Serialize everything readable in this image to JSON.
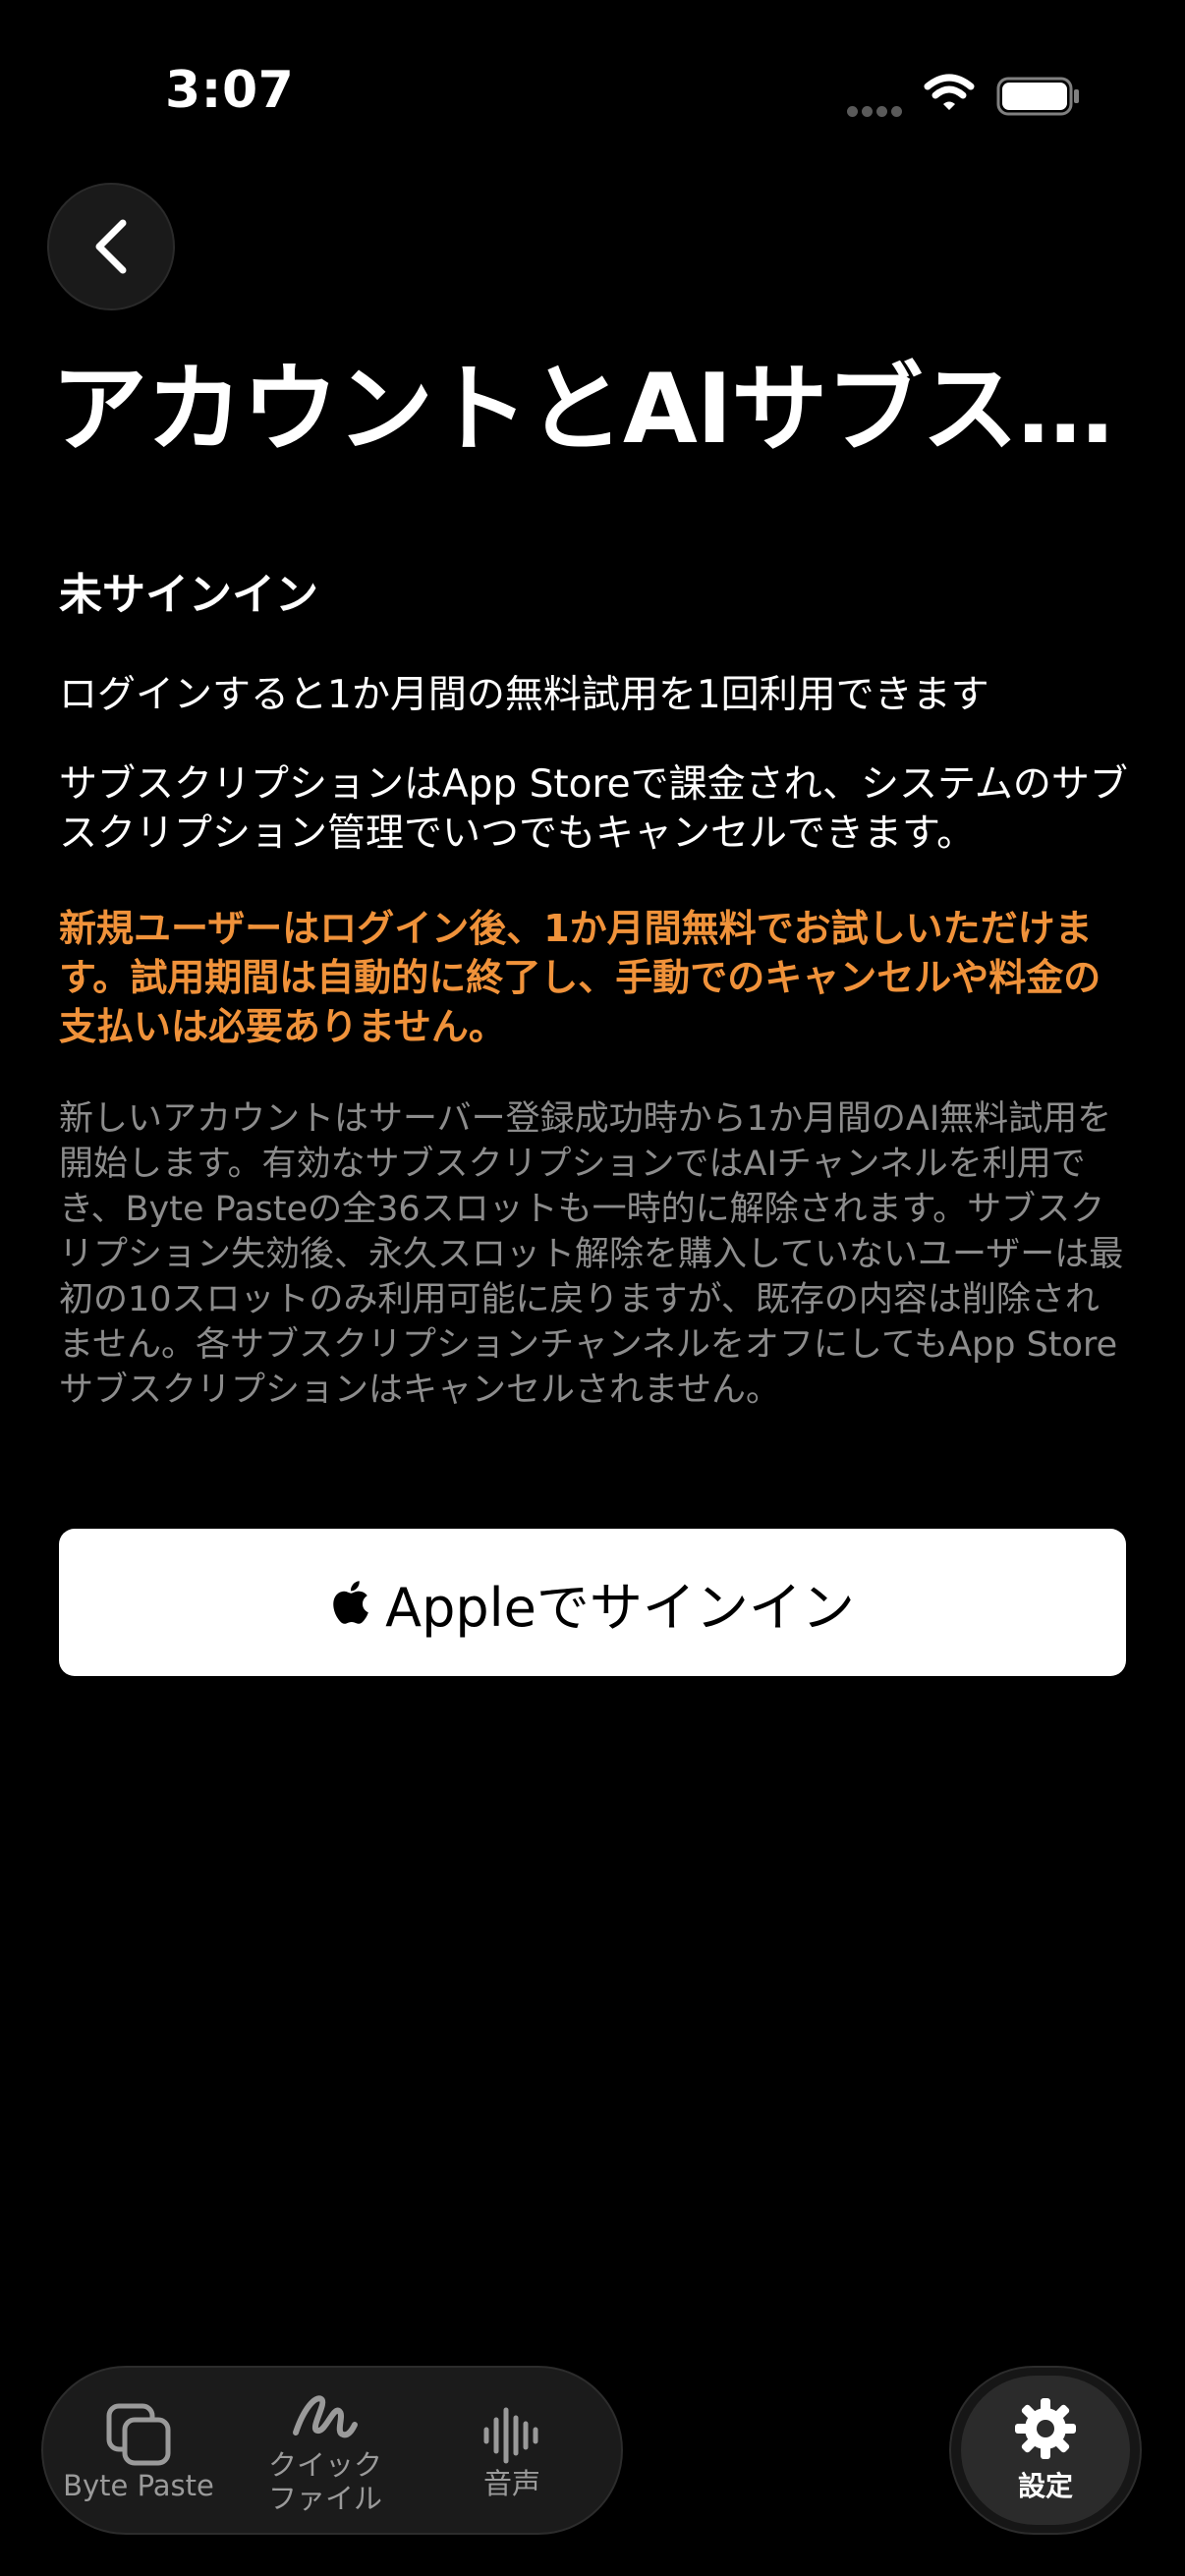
{
  "status_bar": {
    "time": "3:07"
  },
  "header": {
    "title": "アカウントとAIサブス…"
  },
  "account": {
    "status": "未サインイン",
    "trial_info": "ログインすると1か月間の無料試用を1回利用できます",
    "subscription_info": "サブスクリプションはApp Storeで課金され、システムのサブスクリプション管理でいつでもキャンセルできます。",
    "promo": "新規ユーザーはログイン後、1か月間無料でお試しいただけます。試用期間は自動的に終了し、手動でのキャンセルや料金の支払いは必要ありません。",
    "fine_print": "新しいアカウントはサーバー登録成功時から1か月間のAI無料試用を開始します。有効なサブスクリプションではAIチャンネルを利用でき、Byte Pasteの全36スロットも一時的に解除されます。サブスクリプション失効後、永久スロット解除を購入していないユーザーは最初の10スロットのみ利用可能に戻りますが、既存の内容は削除されません。各サブスクリプションチャンネルをオフにしてもApp Storeサブスクリプションはキャンセルされません。"
  },
  "signin_button": {
    "label": "Appleでサインイン",
    "icon": "apple-icon"
  },
  "tabs": [
    {
      "label": "Byte Paste",
      "icon": "copy-icon"
    },
    {
      "label": "クイック\nファイル",
      "icon": "scribble-icon"
    },
    {
      "label": "音声",
      "icon": "waveform-icon"
    }
  ],
  "settings_tab": {
    "label": "設定",
    "icon": "gear-icon"
  },
  "colors": {
    "background": "#000000",
    "promo": "#f0923a",
    "fine_print": "#8c8c8c",
    "button": "#ffffff"
  }
}
